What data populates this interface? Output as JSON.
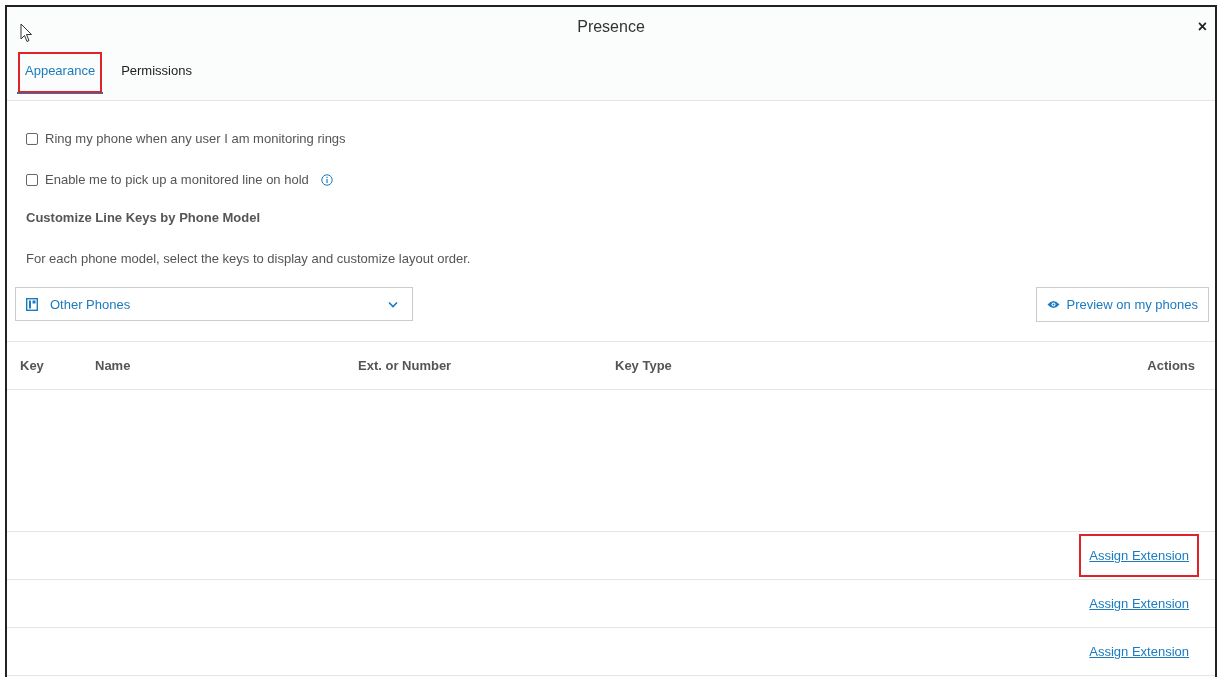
{
  "window": {
    "title": "Presence",
    "close": "×"
  },
  "tabs": [
    {
      "label": "Appearance",
      "selected": true,
      "highlighted": true
    },
    {
      "label": "Permissions",
      "selected": false,
      "highlighted": false
    }
  ],
  "options": [
    {
      "label": "Ring my phone when any user I am monitoring rings",
      "checked": false,
      "info": false
    },
    {
      "label": "Enable me to pick up a monitored line on hold",
      "checked": false,
      "info": true
    }
  ],
  "section": {
    "heading": "Customize Line Keys by Phone Model",
    "description": "For each phone model, select the keys to display and customize layout order."
  },
  "phone_select": {
    "value": "Other Phones"
  },
  "preview_button": "Preview on my phones",
  "table": {
    "columns": [
      "Key",
      "Name",
      "Ext. or Number",
      "Key Type",
      "Actions"
    ],
    "rows": [
      {
        "action": "Assign Extension",
        "highlighted": true
      },
      {
        "action": "Assign Extension",
        "highlighted": false
      },
      {
        "action": "Assign Extension",
        "highlighted": false
      }
    ]
  }
}
